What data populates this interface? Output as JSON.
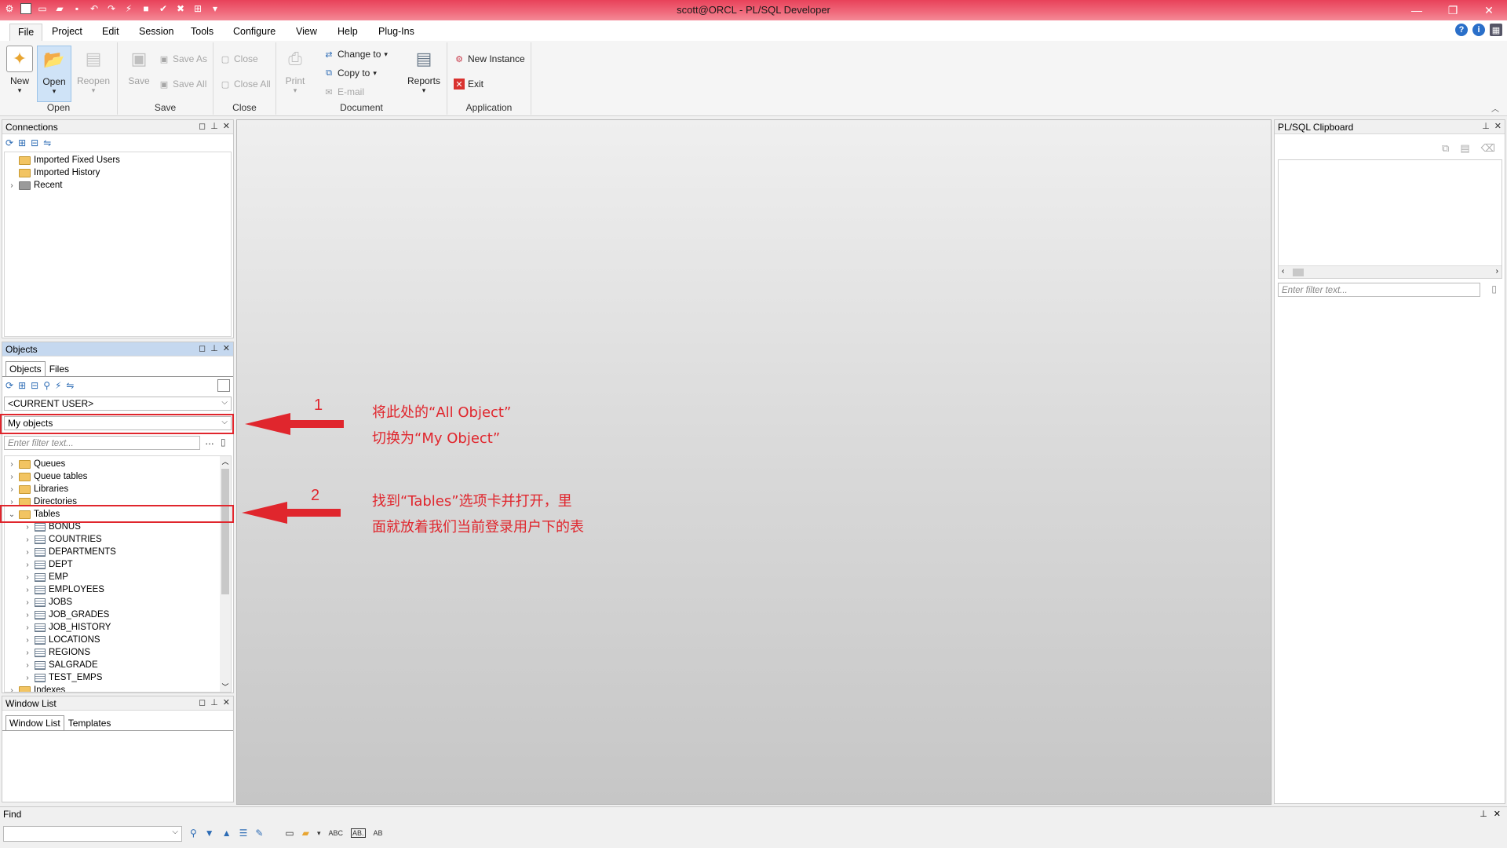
{
  "window": {
    "title": "scott@ORCL - PL/SQL Developer",
    "controls": [
      "—",
      "❐",
      "✕"
    ]
  },
  "menu": {
    "tabs": [
      "File",
      "Project",
      "Edit",
      "Session",
      "Tools",
      "Configure",
      "View",
      "Help",
      "Plug-Ins"
    ]
  },
  "ribbon": {
    "open_group": {
      "label": "Open",
      "new": "New",
      "open": "Open",
      "reopen": "Reopen"
    },
    "save_group": {
      "label": "Save",
      "save": "Save",
      "save_as": "Save As",
      "save_all": "Save All"
    },
    "close_group": {
      "label": "Close",
      "close": "Close",
      "close_all": "Close All"
    },
    "document_group": {
      "label": "Document",
      "print": "Print",
      "change_to": "Change to",
      "copy_to": "Copy to",
      "email": "E-mail",
      "reports": "Reports"
    },
    "application_group": {
      "label": "Application",
      "new_instance": "New Instance",
      "exit": "Exit"
    }
  },
  "connections": {
    "title": "Connections",
    "items": [
      "Imported Fixed Users",
      "Imported History",
      "Recent"
    ]
  },
  "objects": {
    "title": "Objects",
    "tabs": [
      "Objects",
      "Files"
    ],
    "user_select": "<CURRENT USER>",
    "scope_select": "My objects",
    "filter_placeholder": "Enter filter text...",
    "folders_top": [
      "Queues",
      "Queue tables",
      "Libraries",
      "Directories"
    ],
    "tables_label": "Tables",
    "tables": [
      "BONUS",
      "COUNTRIES",
      "DEPARTMENTS",
      "DEPT",
      "EMP",
      "EMPLOYEES",
      "JOBS",
      "JOB_GRADES",
      "JOB_HISTORY",
      "LOCATIONS",
      "REGIONS",
      "SALGRADE",
      "TEST_EMPS"
    ],
    "folder_bottom": "Indexes"
  },
  "window_list": {
    "title": "Window List",
    "tabs": [
      "Window List",
      "Templates"
    ]
  },
  "clipboard": {
    "title": "PL/SQL Clipboard",
    "filter_placeholder": "Enter filter text..."
  },
  "find": {
    "title": "Find",
    "tool_labels": [
      "ABC",
      "AB"
    ]
  },
  "annotations": {
    "n1": "1",
    "n2": "2",
    "note1_line1": "将此处的“All Object”",
    "note1_line2": "切换为“My Object”",
    "note2_line1": "找到“Tables”选项卡并打开，里",
    "note2_line2": "面就放着我们当前登录用户下的表",
    "color": "#e0262d"
  }
}
